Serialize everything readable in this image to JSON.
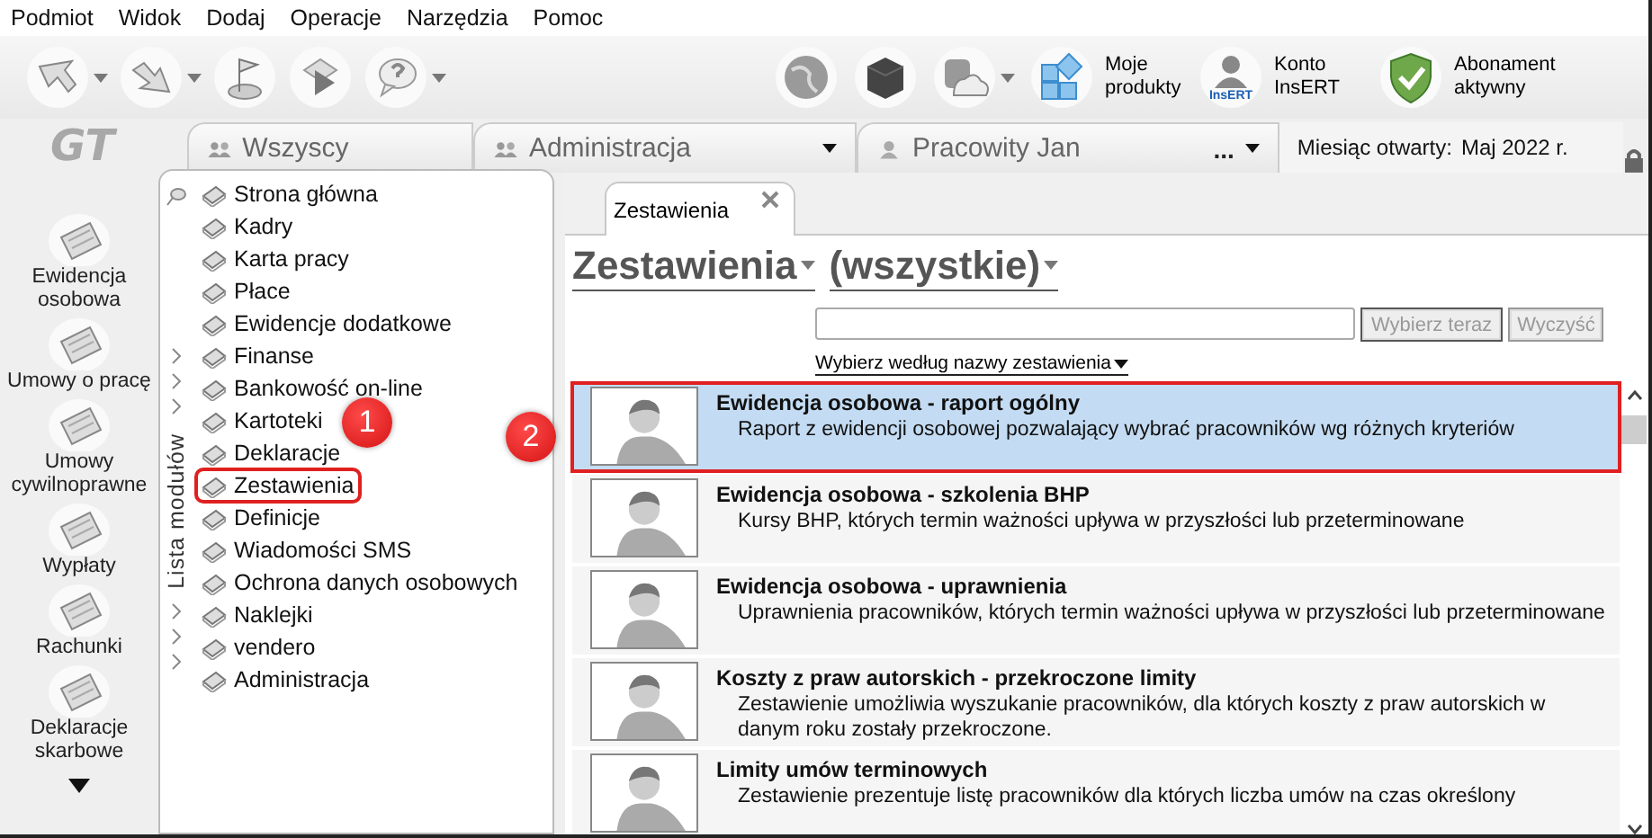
{
  "menu_bar": [
    "Podmiot",
    "Widok",
    "Dodaj",
    "Operacje",
    "Narzędzia",
    "Pomoc"
  ],
  "toolbar": {
    "left_buttons": [
      {
        "dropdown": true
      },
      {
        "dropdown": true
      },
      {
        "dropdown": false
      },
      {
        "dropdown": false
      },
      {
        "dropdown": true
      }
    ],
    "right_buttons": [
      {
        "dropdown": false
      },
      {
        "dropdown": false
      },
      {
        "dropdown": true
      }
    ],
    "labeled_buttons": [
      {
        "label": "Moje produkty"
      },
      {
        "label": "Konto InsERT",
        "icon_text": "InsERT"
      },
      {
        "label": "Abonament aktywny"
      }
    ]
  },
  "logo": "GT",
  "context_bar": {
    "tabs": [
      {
        "label": "Wszyscy",
        "dropdown": false
      },
      {
        "label": "Administracja",
        "dropdown": true
      },
      {
        "label": "Pracowity Jan",
        "more": "...",
        "dropdown": true
      }
    ],
    "month": {
      "label": "Miesiąc otwarty:",
      "value": "Maj 2022 r."
    }
  },
  "left_nav": {
    "items": [
      {
        "label": "Ewidencja osobowa"
      },
      {
        "label": "Umowy o pracę"
      },
      {
        "label": "Umowy cywilnoprawne"
      },
      {
        "label": "Wypłaty"
      },
      {
        "label": "Rachunki"
      },
      {
        "label": "Deklaracje skarbowe"
      }
    ]
  },
  "module_list": {
    "title": "Lista modułów",
    "items": [
      {
        "label": "Strona główna",
        "annotated": false
      },
      {
        "label": "Kadry",
        "annotated": false
      },
      {
        "label": "Karta pracy",
        "annotated": false
      },
      {
        "label": "Płace",
        "annotated": false
      },
      {
        "label": "Ewidencje dodatkowe",
        "annotated": false
      },
      {
        "label": "Finanse",
        "annotated": false
      },
      {
        "label": "Bankowość on-line",
        "annotated": false
      },
      {
        "label": "Kartoteki",
        "annotated": false
      },
      {
        "label": "Deklaracje",
        "annotated": false
      },
      {
        "label": "Zestawienia",
        "annotated": true
      },
      {
        "label": "Definicje",
        "annotated": false
      },
      {
        "label": "Wiadomości SMS",
        "annotated": false
      },
      {
        "label": "Ochrona danych osobowych",
        "annotated": false
      },
      {
        "label": "Naklejki",
        "annotated": false
      },
      {
        "label": "vendero",
        "annotated": false
      },
      {
        "label": "Administracja",
        "annotated": false
      }
    ]
  },
  "content": {
    "tabs": [
      {
        "label": "Zestawienia",
        "selected": true,
        "closable": true
      }
    ],
    "heading": {
      "category": "Zestawienia",
      "filter": "(wszystkie)"
    },
    "buttons": [
      {
        "label": "Wybierz teraz",
        "disabled": true
      },
      {
        "label": "Wyczyść",
        "disabled": true
      }
    ],
    "search_mode": "Wybierz według nazwy zestawienia",
    "reports": [
      {
        "title": "Ewidencja osobowa - raport ogólny",
        "description": "Raport z ewidencji osobowej pozwalający wybrać pracowników wg różnych kryteriów",
        "selected": true,
        "annotated": true
      },
      {
        "title": "Ewidencja osobowa - szkolenia BHP",
        "description": "Kursy BHP, których termin ważności upływa w przyszłości lub przeterminowane",
        "selected": false,
        "annotated": false
      },
      {
        "title": "Ewidencja osobowa - uprawnienia",
        "description": "Uprawnienia pracowników, których termin ważności upływa w przyszłości lub przeterminowane",
        "selected": false,
        "annotated": false
      },
      {
        "title": "Koszty z praw autorskich - przekroczone limity",
        "description": "Zestawienie umożliwia wyszukanie pracowników, dla których koszty z praw autorskich w danym roku zostały przekroczone.",
        "selected": false,
        "annotated": false
      },
      {
        "title": "Limity umów terminowych",
        "description": "Zestawienie prezentuje listę pracowników dla których liczba umów na czas określony",
        "selected": false,
        "annotated": false
      }
    ]
  },
  "callouts": [
    {
      "label": "1"
    },
    {
      "label": "2"
    }
  ]
}
